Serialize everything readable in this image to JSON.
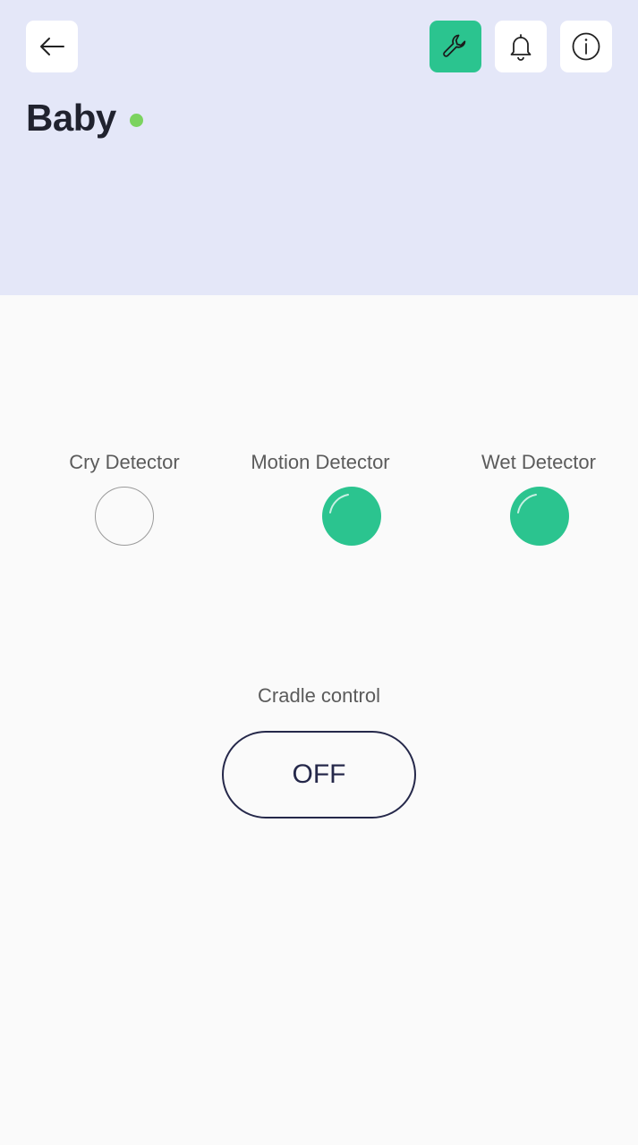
{
  "header": {
    "title": "Baby",
    "status_color": "#7bd35f",
    "background": "#e4e7f8",
    "buttons": {
      "back_icon": "arrow-left-icon",
      "settings_icon": "wrench-icon",
      "settings_color": "#2bc48f",
      "notifications_icon": "bell-icon",
      "info_icon": "info-icon"
    }
  },
  "detectors": [
    {
      "label": "Cry Detector",
      "active": false
    },
    {
      "label": "Motion Detector",
      "active": true
    },
    {
      "label": "Wet Detector",
      "active": true
    }
  ],
  "detector_active_color": "#2bc48f",
  "cradle": {
    "label": "Cradle control",
    "state_label": "OFF"
  }
}
